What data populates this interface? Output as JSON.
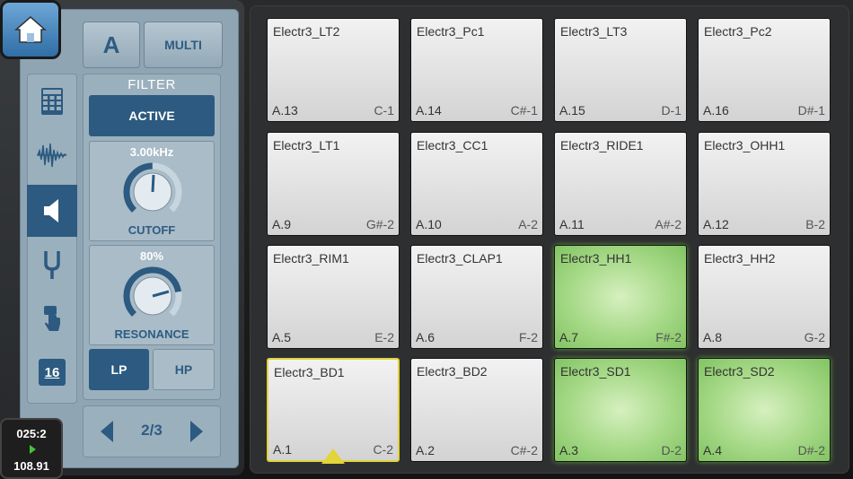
{
  "top": {
    "a_label": "A",
    "multi_label": "MULTI"
  },
  "filter": {
    "title": "FILTER",
    "active_label": "ACTIVE",
    "cutoff": {
      "value_text": "3.00kHz",
      "label": "CUTOFF",
      "level": 0.5
    },
    "resonance": {
      "value_text": "80%",
      "label": "RESONANCE",
      "level": 0.8
    },
    "lp_label": "LP",
    "hp_label": "HP"
  },
  "sidebar": {
    "items": [
      {
        "icon": "grid-icon"
      },
      {
        "icon": "waveform-icon"
      },
      {
        "icon": "speaker-icon",
        "active": true
      },
      {
        "icon": "tuning-fork-icon"
      },
      {
        "icon": "hand-press-icon"
      },
      {
        "icon": "16-badge-icon",
        "text": "16"
      }
    ]
  },
  "pager": {
    "text": "2/3"
  },
  "transport": {
    "position": "025:2",
    "tempo": "108.91"
  },
  "colors": {
    "accent": "#2c5a80",
    "lit_pad": "#a6d987",
    "selected": "#e3d43a"
  },
  "pads": [
    {
      "name": "Electr3_LT2",
      "id": "A.13",
      "note": "C-1"
    },
    {
      "name": "Electr3_Pc1",
      "id": "A.14",
      "note": "C#-1"
    },
    {
      "name": "Electr3_LT3",
      "id": "A.15",
      "note": "D-1"
    },
    {
      "name": "Electr3_Pc2",
      "id": "A.16",
      "note": "D#-1"
    },
    {
      "name": "Electr3_LT1",
      "id": "A.9",
      "note": "G#-2"
    },
    {
      "name": "Electr3_CC1",
      "id": "A.10",
      "note": "A-2"
    },
    {
      "name": "Electr3_RIDE1",
      "id": "A.11",
      "note": "A#-2"
    },
    {
      "name": "Electr3_OHH1",
      "id": "A.12",
      "note": "B-2"
    },
    {
      "name": "Electr3_RIM1",
      "id": "A.5",
      "note": "E-2"
    },
    {
      "name": "Electr3_CLAP1",
      "id": "A.6",
      "note": "F-2"
    },
    {
      "name": "Electr3_HH1",
      "id": "A.7",
      "note": "F#-2",
      "lit": true
    },
    {
      "name": "Electr3_HH2",
      "id": "A.8",
      "note": "G-2"
    },
    {
      "name": "Electr3_BD1",
      "id": "A.1",
      "note": "C-2",
      "selected": true
    },
    {
      "name": "Electr3_BD2",
      "id": "A.2",
      "note": "C#-2"
    },
    {
      "name": "Electr3_SD1",
      "id": "A.3",
      "note": "D-2",
      "lit": true
    },
    {
      "name": "Electr3_SD2",
      "id": "A.4",
      "note": "D#-2",
      "lit": true
    }
  ]
}
